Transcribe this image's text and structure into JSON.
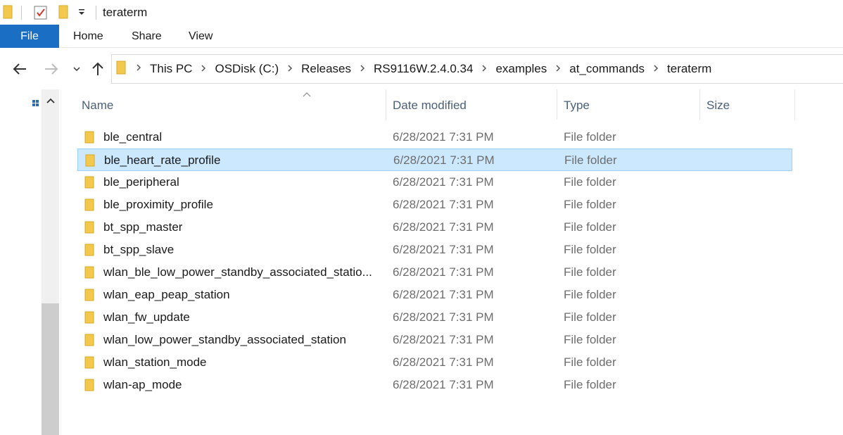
{
  "window": {
    "title": "teraterm"
  },
  "ribbon": {
    "tabs": [
      {
        "label": "File"
      },
      {
        "label": "Home"
      },
      {
        "label": "Share"
      },
      {
        "label": "View"
      }
    ]
  },
  "address": {
    "breadcrumbs": [
      "This PC",
      "OSDisk (C:)",
      "Releases",
      "RS9116W.2.4.0.34",
      "examples",
      "at_commands",
      "teraterm"
    ]
  },
  "columns": {
    "name": "Name",
    "date": "Date modified",
    "type": "Type",
    "size": "Size"
  },
  "files": [
    {
      "name": "ble_central",
      "date": "6/28/2021 7:31 PM",
      "type": "File folder",
      "size": "",
      "selected": false
    },
    {
      "name": "ble_heart_rate_profile",
      "date": "6/28/2021 7:31 PM",
      "type": "File folder",
      "size": "",
      "selected": true
    },
    {
      "name": "ble_peripheral",
      "date": "6/28/2021 7:31 PM",
      "type": "File folder",
      "size": "",
      "selected": false
    },
    {
      "name": "ble_proximity_profile",
      "date": "6/28/2021 7:31 PM",
      "type": "File folder",
      "size": "",
      "selected": false
    },
    {
      "name": "bt_spp_master",
      "date": "6/28/2021 7:31 PM",
      "type": "File folder",
      "size": "",
      "selected": false
    },
    {
      "name": "bt_spp_slave",
      "date": "6/28/2021 7:31 PM",
      "type": "File folder",
      "size": "",
      "selected": false
    },
    {
      "name": "wlan_ble_low_power_standby_associated_statio...",
      "date": "6/28/2021 7:31 PM",
      "type": "File folder",
      "size": "",
      "selected": false
    },
    {
      "name": "wlan_eap_peap_station",
      "date": "6/28/2021 7:31 PM",
      "type": "File folder",
      "size": "",
      "selected": false
    },
    {
      "name": "wlan_fw_update",
      "date": "6/28/2021 7:31 PM",
      "type": "File folder",
      "size": "",
      "selected": false
    },
    {
      "name": "wlan_low_power_standby_associated_station",
      "date": "6/28/2021 7:31 PM",
      "type": "File folder",
      "size": "",
      "selected": false
    },
    {
      "name": "wlan_station_mode",
      "date": "6/28/2021 7:31 PM",
      "type": "File folder",
      "size": "",
      "selected": false
    },
    {
      "name": "wlan-ap_mode",
      "date": "6/28/2021 7:31 PM",
      "type": "File folder",
      "size": "",
      "selected": false
    }
  ],
  "colors": {
    "accent": "#1a6fc4",
    "selection_bg": "#cce8ff",
    "selection_border": "#99d1ff",
    "folder": "#f2c94c"
  }
}
